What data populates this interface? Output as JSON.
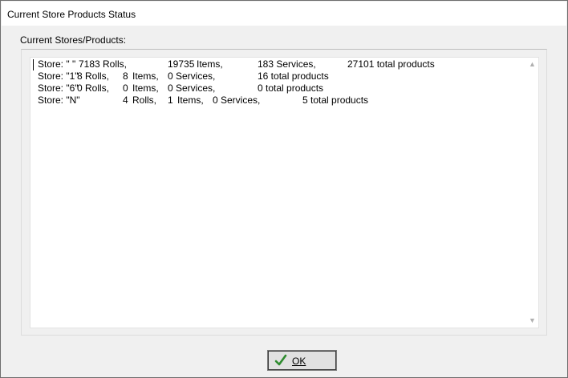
{
  "window": {
    "title": "Current Store Products Status"
  },
  "group": {
    "label": "Current Stores/Products:"
  },
  "memo": {
    "lines": [
      {
        "store": "Store: \" \"",
        "rolls_num": "7183",
        "rolls": "Rolls,",
        "items_num": "19735",
        "items": "Items,",
        "services": "183 Services,",
        "total": "27101 total products"
      },
      {
        "store": "Store: \"1\"",
        "rolls_num": "8",
        "rolls": "Rolls,",
        "items_num": "8",
        "items": "Items,",
        "services": "0 Services,",
        "total": "16 total products"
      },
      {
        "store": "Store: \"6\"",
        "rolls_num": "0",
        "rolls": "Rolls,",
        "items_num": "0",
        "items": "Items,",
        "services": "0 Services,",
        "total": "0 total products"
      },
      {
        "store": "Store: \"N\"",
        "rolls_num": "4",
        "rolls": "Rolls,",
        "items_num": "1",
        "items": "Items,",
        "services": "0 Services,",
        "total": "5 total products"
      }
    ]
  },
  "buttons": {
    "ok_label": "OK"
  },
  "icons": {
    "ok": "checkmark-icon",
    "scroll_up": "scroll-up-icon",
    "scroll_down": "scroll-down-icon"
  },
  "colors": {
    "check_green": "#2e8b2e"
  }
}
